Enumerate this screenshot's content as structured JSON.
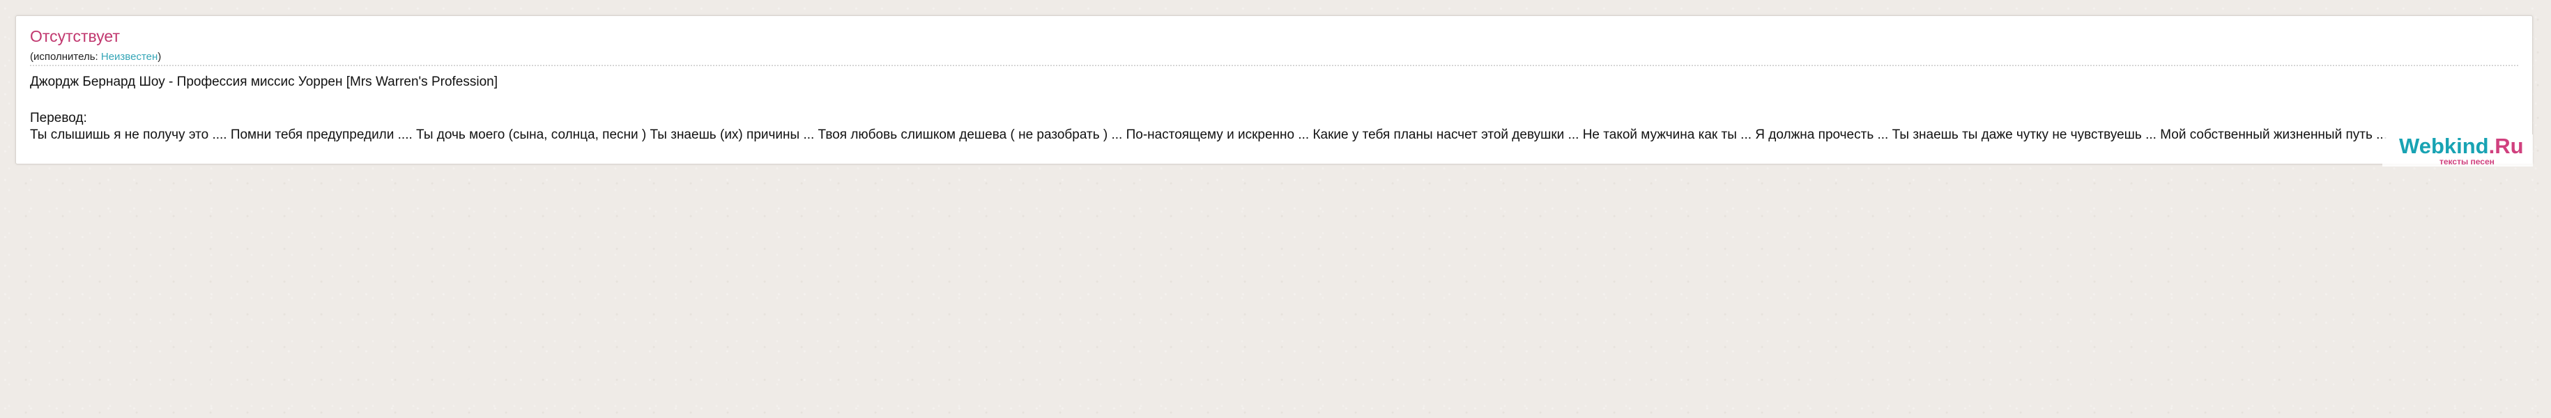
{
  "song": {
    "title": "Отсутствует",
    "performer_prefix": "(исполнитель: ",
    "performer_name": "Неизвестен",
    "performer_suffix": ")",
    "subtitle": "Джордж Бернард Шоу - Профессия миссис Уоррен [Mrs Warren's Profession]"
  },
  "translation": {
    "label": "Перевод:",
    "text": "Ты слышишь я не получу это .... Помни тебя предупредили .... Ты дочь моего (сына, солнца, песни ) Ты знаешь (их) причины ... Твоя любовь слишком дешева ( не разобрать ) ... По-настоящему и искренно ... Какие у тебя планы насчет этой девушки ... Не такой мужчина как ты ... Я должна прочесть ... Ты знаешь ты даже чутку не чувствуешь ... Мой собственный жизненный путь ..."
  },
  "logo": {
    "brand": "Webkind",
    "tld": ".Ru",
    "tagline": "тексты песен"
  },
  "colors": {
    "title": "#c1386f",
    "performer_link": "#35a6b7",
    "logo_teal": "#18a3b3",
    "logo_pink": "#d0407e",
    "background": "#efebe7"
  }
}
